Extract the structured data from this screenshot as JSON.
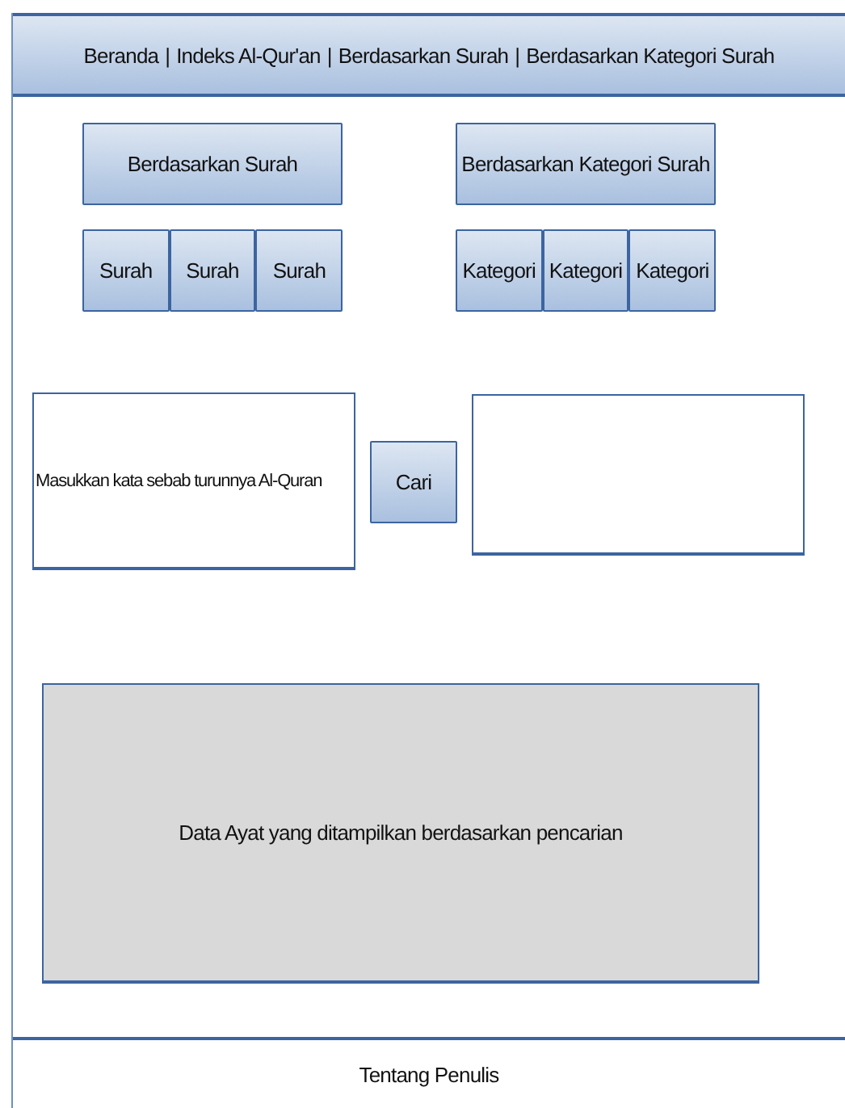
{
  "nav": {
    "separator": "|",
    "items": [
      {
        "label": "Beranda"
      },
      {
        "label": "Indeks Al-Qur'an"
      },
      {
        "label": "Berdasarkan Surah"
      },
      {
        "label": "Berdasarkan Kategori Surah"
      }
    ]
  },
  "groups": [
    {
      "title": "Berdasarkan Surah",
      "options": [
        "Surah",
        "Surah",
        "Surah"
      ]
    },
    {
      "title": "Berdasarkan Kategori Surah",
      "options": [
        "Kategori",
        "Kategori",
        "Kategori"
      ]
    }
  ],
  "search": {
    "placeholder": "Masukkan kata sebab turunnya Al-Quran",
    "button": "Cari"
  },
  "results": {
    "text": "Data Ayat yang ditampilkan berdasarkan pencarian"
  },
  "footer": {
    "link": "Tentang Penulis"
  }
}
